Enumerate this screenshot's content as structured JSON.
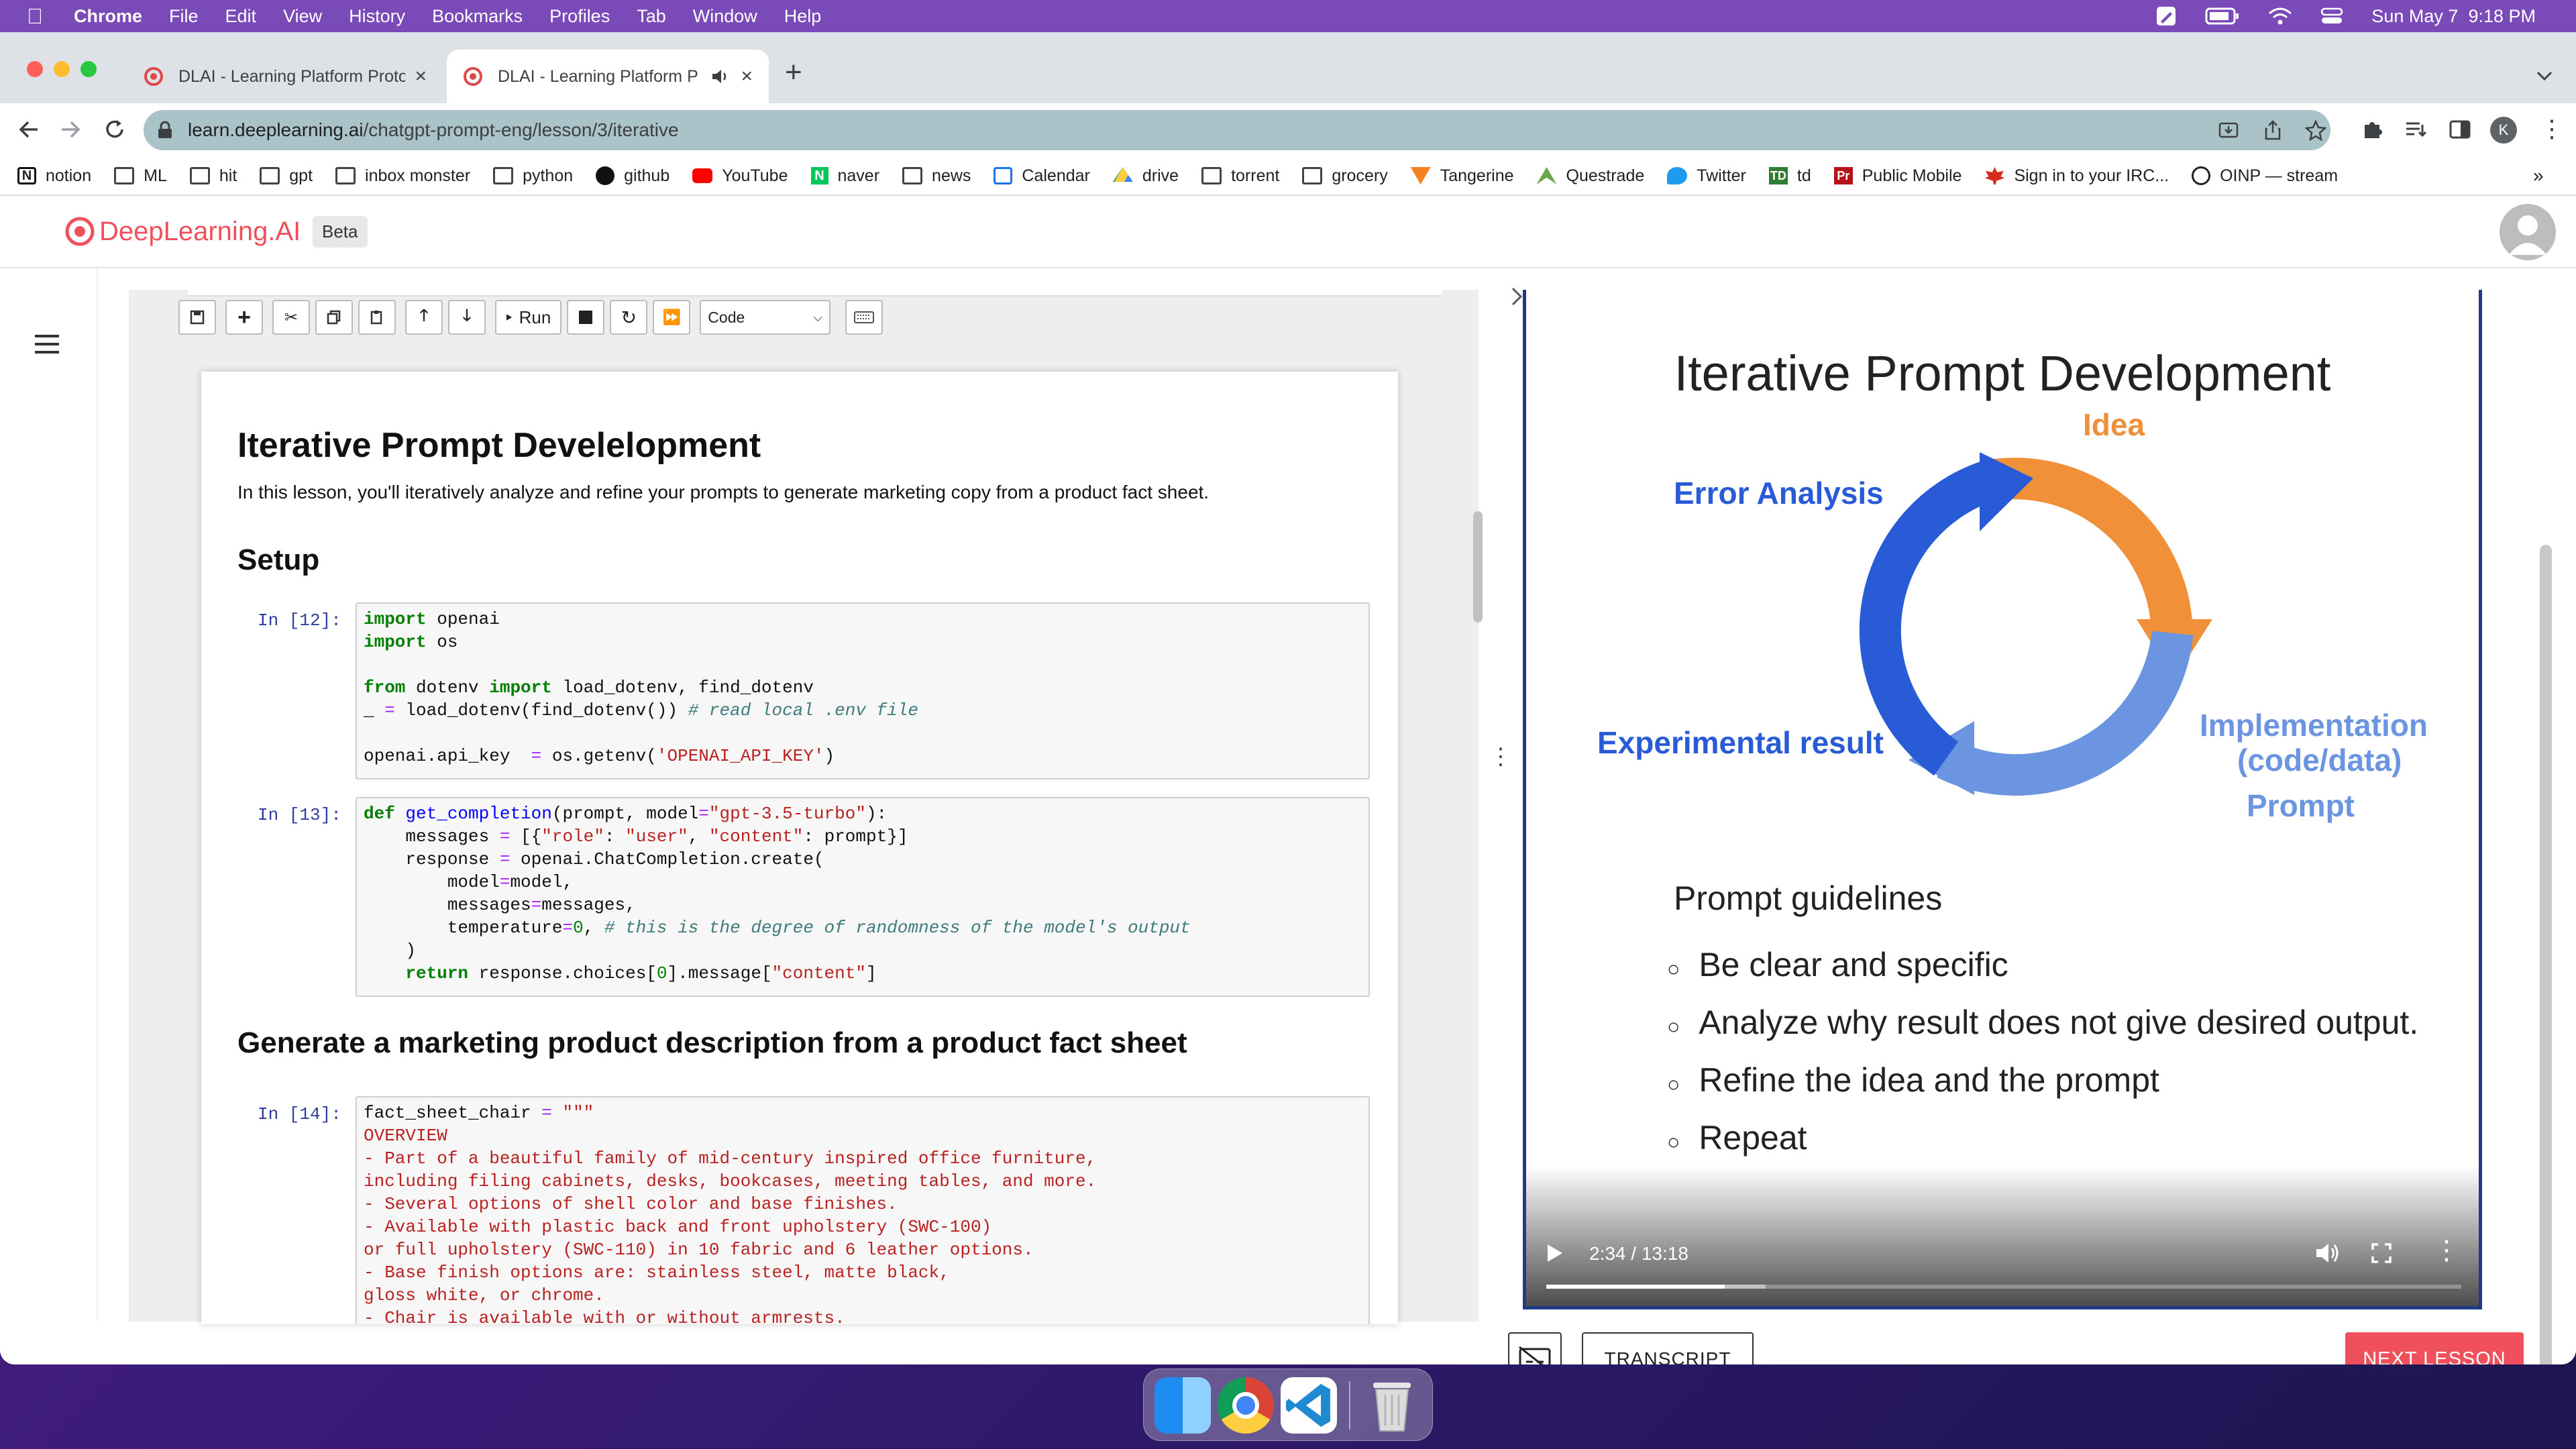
{
  "menubar": {
    "app": "Chrome",
    "items": [
      "File",
      "Edit",
      "View",
      "History",
      "Bookmarks",
      "Profiles",
      "Tab",
      "Window",
      "Help"
    ],
    "datetime": "Sun May 7  9:18 PM"
  },
  "tabs": [
    {
      "title": "DLAI - Learning Platform Proto"
    },
    {
      "title": "DLAI - Learning Platform P"
    }
  ],
  "address_bar": {
    "host": "learn.deeplearning.ai",
    "path": "/chatgpt-prompt-eng/lesson/3/iterative"
  },
  "profile_initial": "K",
  "bookmarks": [
    {
      "label": "notion",
      "icon": "notion-icon"
    },
    {
      "label": "ML",
      "icon": "folder-icon"
    },
    {
      "label": "hit",
      "icon": "folder-icon"
    },
    {
      "label": "gpt",
      "icon": "folder-icon"
    },
    {
      "label": "inbox monster",
      "icon": "folder-icon"
    },
    {
      "label": "python",
      "icon": "folder-icon"
    },
    {
      "label": "github",
      "icon": "github-icon"
    },
    {
      "label": "YouTube",
      "icon": "youtube-icon"
    },
    {
      "label": "naver",
      "icon": "naver-icon"
    },
    {
      "label": "news",
      "icon": "folder-icon"
    },
    {
      "label": "Calendar",
      "icon": "calendar-icon"
    },
    {
      "label": "drive",
      "icon": "drive-icon"
    },
    {
      "label": "torrent",
      "icon": "folder-icon"
    },
    {
      "label": "grocery",
      "icon": "folder-icon"
    },
    {
      "label": "Tangerine",
      "icon": "tangerine-icon"
    },
    {
      "label": "Questrade",
      "icon": "questrade-icon"
    },
    {
      "label": "Twitter",
      "icon": "twitter-icon"
    },
    {
      "label": "td",
      "icon": "td-icon"
    },
    {
      "label": "Public Mobile",
      "icon": "public-mobile-icon"
    },
    {
      "label": "Sign in to your IRC...",
      "icon": "maple-leaf-icon"
    },
    {
      "label": "OINP — stream",
      "icon": "globe-icon"
    }
  ],
  "site": {
    "logo": "DeepLearning.AI",
    "badge": "Beta"
  },
  "notebook": {
    "run_label": "Run",
    "cell_type": "Code",
    "title": "Iterative Prompt Develelopment",
    "intro": "In this lesson, you'll iteratively analyze and refine your prompts to generate marketing copy from a product fact sheet.",
    "setup_heading": "Setup",
    "section_heading": "Generate a marketing product description from a product fact sheet",
    "prompts": [
      "In [12]:",
      "In [13]:",
      "In [14]:"
    ]
  },
  "slide": {
    "title": "Iterative Prompt Development",
    "labels": {
      "idea": "Idea",
      "error_analysis": "Error Analysis",
      "experimental_result": "Experimental result",
      "implementation": "Implementation",
      "code_data": "(code/data)",
      "prompt": "Prompt"
    },
    "guidelines_heading": "Prompt guidelines",
    "guidelines": [
      "Be clear and specific",
      "Analyze why result does not give desired output.",
      "Refine the idea and the prompt",
      "Repeat"
    ]
  },
  "video": {
    "time": "2:34 / 13:18",
    "progress": 0.195,
    "buffered": 0.24
  },
  "buttons": {
    "transcript": "TRANSCRIPT",
    "next_lesson": "NEXT LESSON"
  },
  "colors": {
    "accent_red": "#f0505c",
    "slide_blue": "#2a5bd7",
    "slide_orange": "#f0913a",
    "slide_lightblue": "#6b95e0"
  }
}
